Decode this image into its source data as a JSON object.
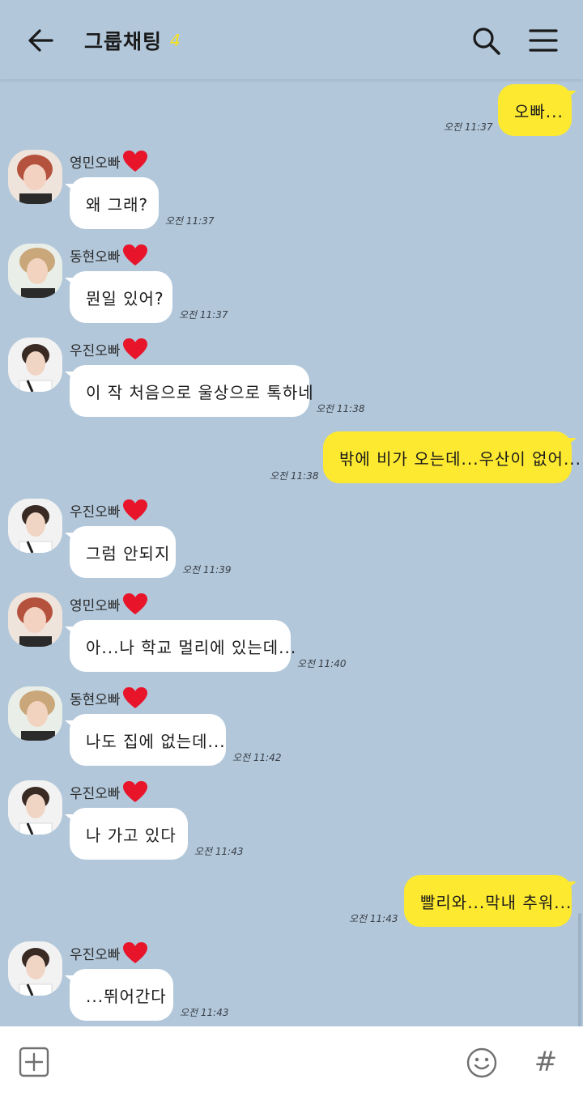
{
  "header": {
    "title": "그룹채팅",
    "member_count": "4"
  },
  "colors": {
    "background": "#b2c7da",
    "my_bubble": "#fde930",
    "other_bubble": "#ffffff",
    "count_color": "#f6e21b",
    "heart": "#e8142a"
  },
  "messages": [
    {
      "from": "me",
      "text": "오빠...",
      "time": "오전 11:37"
    },
    {
      "from": "other",
      "sender": "영민오빠",
      "text": "왜 그래?",
      "time": "오전 11:37"
    },
    {
      "from": "other",
      "sender": "동현오빠",
      "text": "뭔일 있어?",
      "time": "오전 11:37"
    },
    {
      "from": "other",
      "sender": "우진오빠",
      "text": "이 작 처음으로 울상으로 톡하네",
      "time": "오전 11:38"
    },
    {
      "from": "me",
      "text": "밖에 비가 오는데...우산이 없어...",
      "time": "오전 11:38"
    },
    {
      "from": "other",
      "sender": "우진오빠",
      "text": "그럼 안되지",
      "time": "오전 11:39"
    },
    {
      "from": "other",
      "sender": "영민오빠",
      "text": "아...나 학교 멀리에 있는데...",
      "time": "오전 11:40"
    },
    {
      "from": "other",
      "sender": "동현오빠",
      "text": "나도 집에 없는데...",
      "time": "오전 11:42"
    },
    {
      "from": "other",
      "sender": "우진오빠",
      "text": "나 가고 있다",
      "time": "오전 11:43"
    },
    {
      "from": "me",
      "text": "빨리와...막내 추워...",
      "time": "오전 11:43"
    },
    {
      "from": "other",
      "sender": "우진오빠",
      "text": "...뛰어간다",
      "time": "오전 11:43"
    }
  ],
  "footer": {
    "hash_symbol": "#"
  }
}
